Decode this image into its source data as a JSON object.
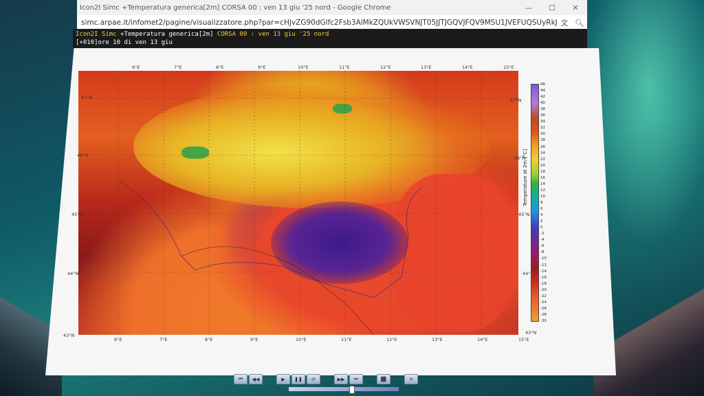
{
  "browser": {
    "title": "Icon2I Simc +Temperatura generica[2m] CORSA 00 : ven 13 giu '25 nord - Google Chrome",
    "url": "simc.arpae.it/infomet2/pagine/visualizzatore.php?par=cHJvZG90dGlfc2Fsb3AlMkZQUkVWSVNJT05JJTJGQVJFQV9MSU1JVEFUQSUyRkJD...",
    "minimize": "—",
    "maximize": "☐",
    "close": "✕"
  },
  "header": {
    "model": "Icon2I Simc",
    "param": "+Temperatura generica[2m]",
    "run": "CORSA 00 : ven 13 giu '25 nord",
    "time": "[+010]ore 10 di ven 13 giu"
  },
  "map": {
    "lon_ticks_top": [
      "6°E",
      "7°E",
      "8°E",
      "9°E",
      "10°E",
      "11°E",
      "12°E",
      "13°E",
      "14°E",
      "15°E"
    ],
    "lon_ticks_bottom": [
      "6°E",
      "7°E",
      "8°E",
      "9°E",
      "10°E",
      "11°E",
      "12°E",
      "13°E",
      "14°E",
      "15°E"
    ],
    "lat_ticks_left": [
      "47°N",
      "46°N",
      "45°N",
      "44°N",
      "43°N"
    ],
    "lat_ticks_right": [
      "47°N",
      "46°N",
      "45°N",
      "44°N",
      "43°N"
    ]
  },
  "colorbar": {
    "title": "Temperature at 2m [°C]",
    "labels": [
      "46",
      "44",
      "42",
      "40",
      "38",
      "36",
      "34",
      "32",
      "30",
      "28",
      "26",
      "24",
      "22",
      "20",
      "18",
      "16",
      "14",
      "12",
      "10",
      "8",
      "6",
      "4",
      "2",
      "0",
      "-2",
      "-4",
      "-6",
      "-8",
      "-10",
      "-12",
      "-14",
      "-16",
      "-18",
      "-20",
      "-22",
      "-24",
      "-26",
      "-28",
      "-30"
    ]
  },
  "toolbar": {
    "buttons": [
      "⏮",
      "◀◀",
      "▶",
      "❚❚",
      "⟳",
      "▶▶",
      "⏭",
      "⬛",
      "✕"
    ]
  }
}
